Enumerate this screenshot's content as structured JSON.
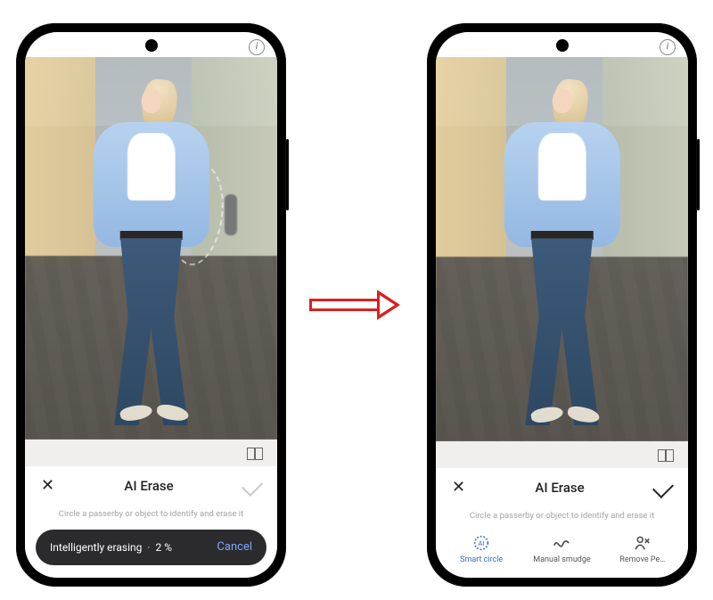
{
  "shared": {
    "title": "AI Erase",
    "hint": "Circle a passerby or object to identify and erase it"
  },
  "left": {
    "progress_label": "Intelligently erasing",
    "progress_separator": "·",
    "progress_value": "2 %",
    "cancel_label": "Cancel"
  },
  "right": {
    "tools": {
      "smart": "Smart circle",
      "manual": "Manual smudge",
      "remove": "Remove Pe…"
    }
  },
  "icons": {
    "info": "i",
    "close": "✕"
  }
}
